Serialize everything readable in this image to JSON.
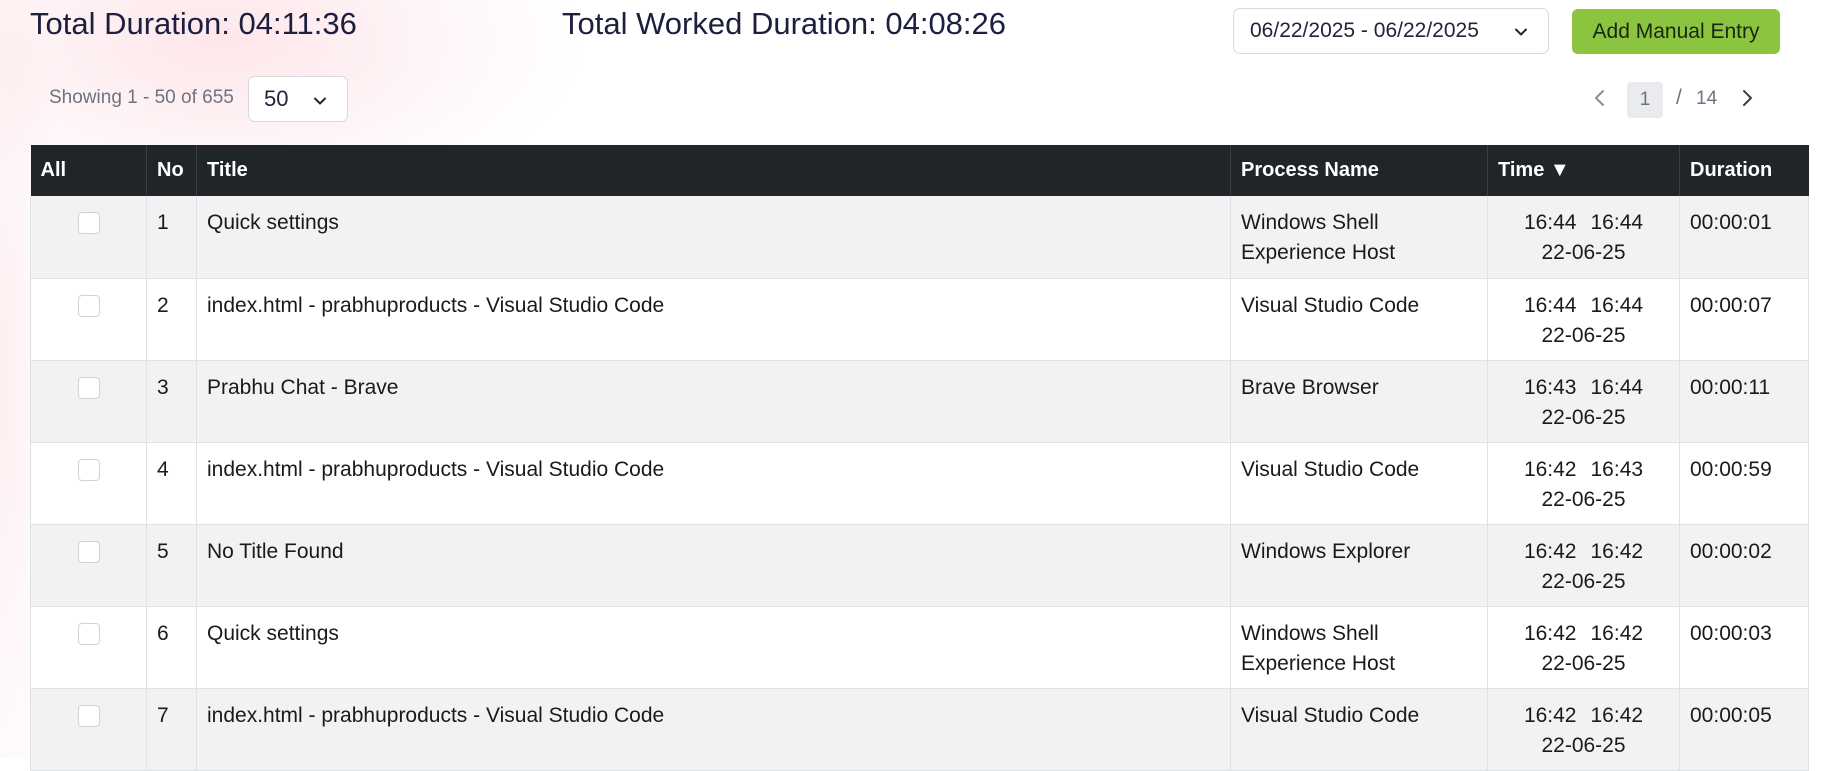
{
  "summary": {
    "total_duration": "Total Duration: 04:11:36",
    "worked_duration": "Total Worked Duration: 04:08:26"
  },
  "toolbar": {
    "date_range": "06/22/2025 - 06/22/2025",
    "add_manual_entry_label": "Add Manual Entry"
  },
  "pagination": {
    "showing_text": "Showing 1 - 50 of 655",
    "page_size": "50",
    "current_page": "1",
    "separator": "/",
    "total_pages": "14"
  },
  "table": {
    "headers": {
      "select_all": "All",
      "no": "No",
      "title": "Title",
      "process_name": "Process Name",
      "time": "Time ▼",
      "duration": "Duration"
    },
    "rows": [
      {
        "no": "1",
        "title": "Quick settings",
        "process": "Windows Shell Experience Host",
        "start": "16:44",
        "end": "16:44",
        "date": "22-06-25",
        "duration": "00:00:01"
      },
      {
        "no": "2",
        "title": "index.html - prabhuproducts - Visual Studio Code",
        "process": "Visual Studio Code",
        "start": "16:44",
        "end": "16:44",
        "date": "22-06-25",
        "duration": "00:00:07"
      },
      {
        "no": "3",
        "title": "Prabhu Chat - Brave",
        "process": "Brave Browser",
        "start": "16:43",
        "end": "16:44",
        "date": "22-06-25",
        "duration": "00:00:11"
      },
      {
        "no": "4",
        "title": "index.html - prabhuproducts - Visual Studio Code",
        "process": "Visual Studio Code",
        "start": "16:42",
        "end": "16:43",
        "date": "22-06-25",
        "duration": "00:00:59"
      },
      {
        "no": "5",
        "title": "No Title Found",
        "process": "Windows Explorer",
        "start": "16:42",
        "end": "16:42",
        "date": "22-06-25",
        "duration": "00:00:02"
      },
      {
        "no": "6",
        "title": "Quick settings",
        "process": "Windows Shell Experience Host",
        "start": "16:42",
        "end": "16:42",
        "date": "22-06-25",
        "duration": "00:00:03"
      },
      {
        "no": "7",
        "title": "index.html - prabhuproducts - Visual Studio Code",
        "process": "Visual Studio Code",
        "start": "16:42",
        "end": "16:42",
        "date": "22-06-25",
        "duration": "00:00:05"
      }
    ]
  },
  "colors": {
    "header_bg": "#212529",
    "accent_button": "#8bc53f",
    "title_text": "#1c1f3f"
  },
  "icons": {
    "dropdown": "chevron-down-icon",
    "prev": "chevron-left-icon",
    "next": "chevron-right-icon"
  }
}
